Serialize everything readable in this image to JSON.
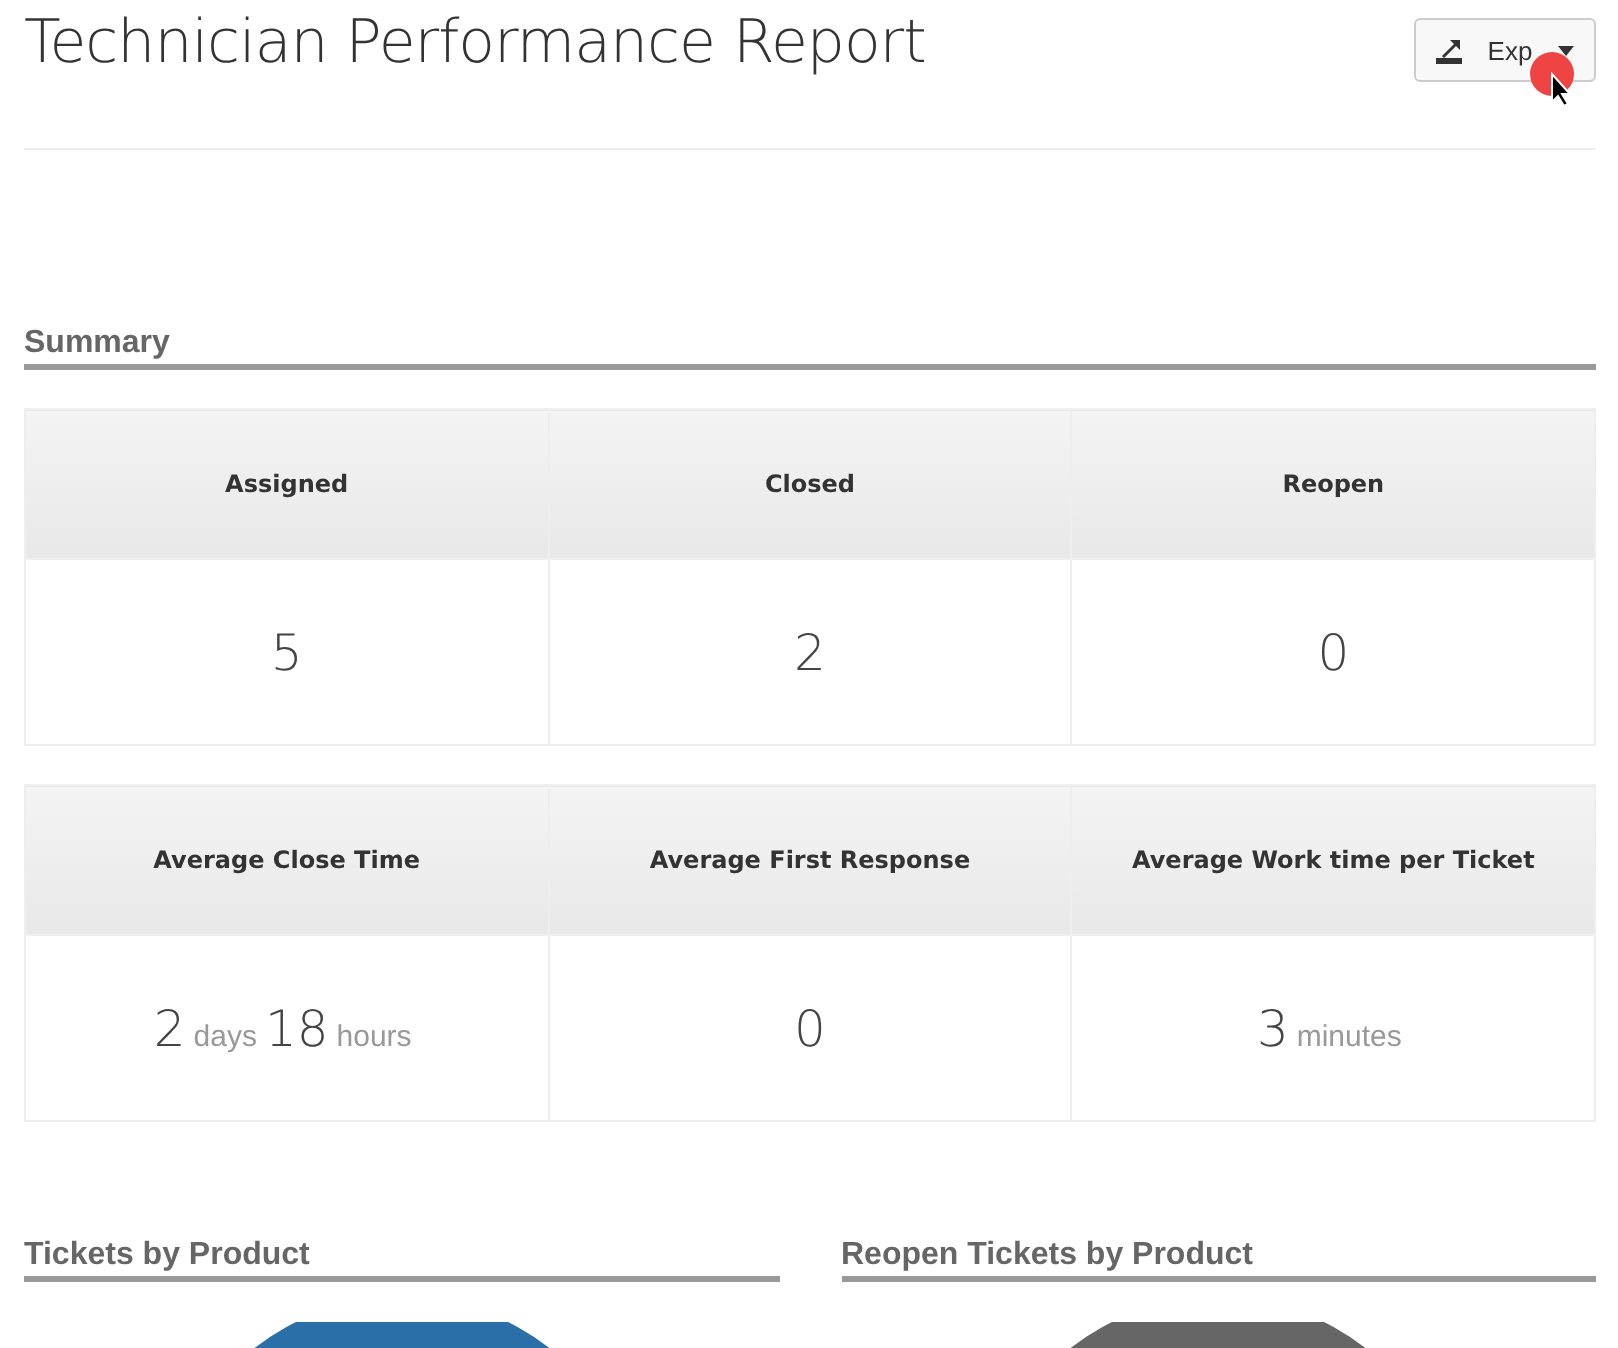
{
  "title": "Technician Performance Report",
  "export_button": {
    "label": "Exp"
  },
  "summary": {
    "heading": "Summary",
    "tables": [
      {
        "columns": [
          "Assigned",
          "Closed",
          "Reopen"
        ],
        "values": [
          [
            {
              "number": "5"
            }
          ],
          [
            {
              "number": "2"
            }
          ],
          [
            {
              "number": "0"
            }
          ]
        ]
      },
      {
        "columns": [
          "Average Close Time",
          "Average First Response",
          "Average Work time per Ticket"
        ],
        "values": [
          [
            {
              "number": "2",
              "unit": "days"
            },
            {
              "number": "18",
              "unit": "hours"
            }
          ],
          [
            {
              "number": "0"
            }
          ],
          [
            {
              "number": "3",
              "unit": "minutes"
            }
          ]
        ]
      }
    ]
  },
  "charts": [
    {
      "heading": "Tickets by Product",
      "color": "#2a6fa8"
    },
    {
      "heading": "Reopen Tickets by Product",
      "color": "#666666"
    }
  ]
}
